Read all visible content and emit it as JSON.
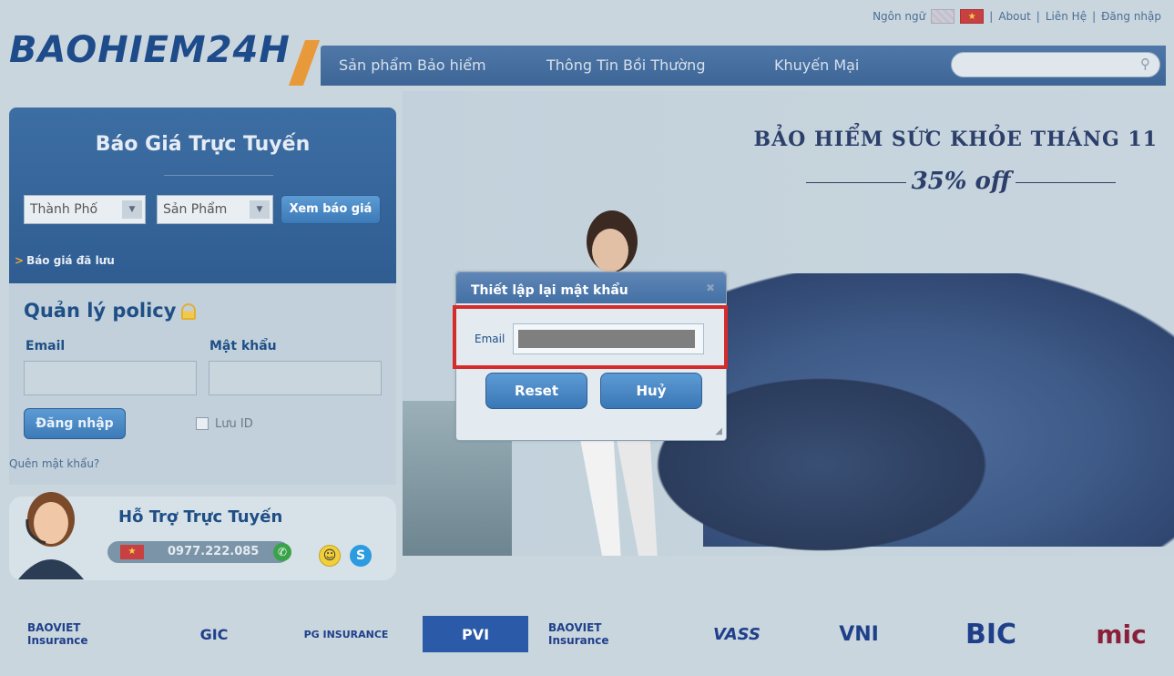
{
  "header": {
    "language_label": "Ngôn ngữ",
    "links": [
      "About",
      "Liên Hệ",
      "Đăng nhập"
    ],
    "separator": "|",
    "logo": "BAOHIEM24H",
    "nav": [
      "Sản phẩm Bảo hiểm",
      "Thông Tin Bồi Thường",
      "Khuyến Mại"
    ]
  },
  "quote": {
    "title": "Báo Giá Trực Tuyến",
    "city_select": "Thành Phố",
    "product_select": "Sản Phẩm",
    "button": "Xem báo giá",
    "saved_link": "Báo giá đã lưu"
  },
  "policy": {
    "title": "Quản lý policy",
    "email_label": "Email",
    "password_label": "Mật khẩu",
    "login_button": "Đăng nhập",
    "remember_label": "Lưu ID",
    "forgot_link": "Quên mật khẩu?"
  },
  "support": {
    "title": "Hỗ Trợ Trực Tuyến",
    "phone": "0977.222.085"
  },
  "promo": {
    "title": "BẢO HIỂM SỨC KHỎE THÁNG 11",
    "subtitle": "35% off"
  },
  "dialog": {
    "title": "Thiết lập lại mật khẩu",
    "email_label": "Email",
    "reset_button": "Reset",
    "cancel_button": "Huỷ"
  },
  "partners": [
    {
      "name": "BAOVIET Insurance",
      "color": "#1f3f8a"
    },
    {
      "name": "GIC",
      "color": "#1f3f8a"
    },
    {
      "name": "PG INSURANCE",
      "color": "#1f3f8a"
    },
    {
      "name": "PVI",
      "color": "#2a5aa8"
    },
    {
      "name": "BAOVIET Insurance",
      "color": "#1f3f8a"
    },
    {
      "name": "VASS",
      "color": "#1f3f8a"
    },
    {
      "name": "VNI",
      "color": "#1f3f8a"
    },
    {
      "name": "BIC",
      "color": "#1f3f8a"
    },
    {
      "name": "mic",
      "color": "#8a1f3a"
    }
  ],
  "colors": {
    "brand_blue": "#1e4b8a",
    "accent_orange": "#e89a3a",
    "highlight_red": "#d62b2b"
  }
}
